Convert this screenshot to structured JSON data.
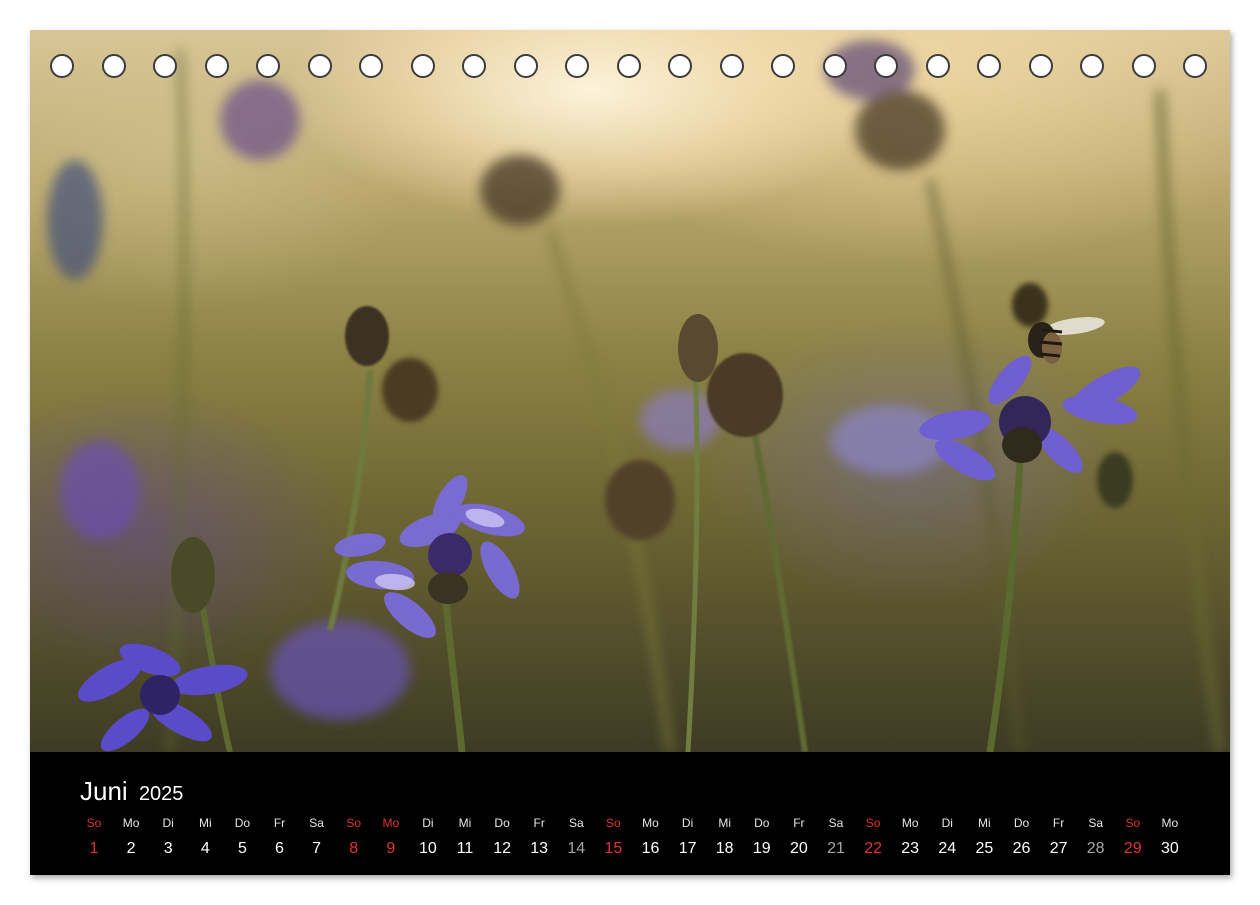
{
  "calendar": {
    "month": "Juni",
    "year": "2025",
    "binding_holes": 23,
    "days": [
      {
        "wd": "So",
        "d": "1",
        "kind": "sunday"
      },
      {
        "wd": "Mo",
        "d": "2",
        "kind": "weekday"
      },
      {
        "wd": "Di",
        "d": "3",
        "kind": "weekday"
      },
      {
        "wd": "Mi",
        "d": "4",
        "kind": "weekday"
      },
      {
        "wd": "Do",
        "d": "5",
        "kind": "weekday"
      },
      {
        "wd": "Fr",
        "d": "6",
        "kind": "weekday"
      },
      {
        "wd": "Sa",
        "d": "7",
        "kind": "weekday"
      },
      {
        "wd": "So",
        "d": "8",
        "kind": "sunday"
      },
      {
        "wd": "Mo",
        "d": "9",
        "kind": "holiday"
      },
      {
        "wd": "Di",
        "d": "10",
        "kind": "weekday"
      },
      {
        "wd": "Mi",
        "d": "11",
        "kind": "weekday"
      },
      {
        "wd": "Do",
        "d": "12",
        "kind": "weekday"
      },
      {
        "wd": "Fr",
        "d": "13",
        "kind": "weekday"
      },
      {
        "wd": "Sa",
        "d": "14",
        "kind": "saturday"
      },
      {
        "wd": "So",
        "d": "15",
        "kind": "sunday"
      },
      {
        "wd": "Mo",
        "d": "16",
        "kind": "weekday"
      },
      {
        "wd": "Di",
        "d": "17",
        "kind": "weekday"
      },
      {
        "wd": "Mi",
        "d": "18",
        "kind": "weekday"
      },
      {
        "wd": "Do",
        "d": "19",
        "kind": "weekday"
      },
      {
        "wd": "Fr",
        "d": "20",
        "kind": "weekday"
      },
      {
        "wd": "Sa",
        "d": "21",
        "kind": "saturday"
      },
      {
        "wd": "So",
        "d": "22",
        "kind": "sunday"
      },
      {
        "wd": "Mo",
        "d": "23",
        "kind": "weekday"
      },
      {
        "wd": "Di",
        "d": "24",
        "kind": "weekday"
      },
      {
        "wd": "Mi",
        "d": "25",
        "kind": "weekday"
      },
      {
        "wd": "Do",
        "d": "26",
        "kind": "weekday"
      },
      {
        "wd": "Fr",
        "d": "27",
        "kind": "weekday"
      },
      {
        "wd": "Sa",
        "d": "28",
        "kind": "saturday"
      },
      {
        "wd": "So",
        "d": "29",
        "kind": "sunday"
      },
      {
        "wd": "Mo",
        "d": "30",
        "kind": "weekday"
      }
    ]
  },
  "colors": {
    "sunday_red": "#e2332f",
    "saturday_gray": "#a6a6a6",
    "bar_background": "#000000"
  }
}
